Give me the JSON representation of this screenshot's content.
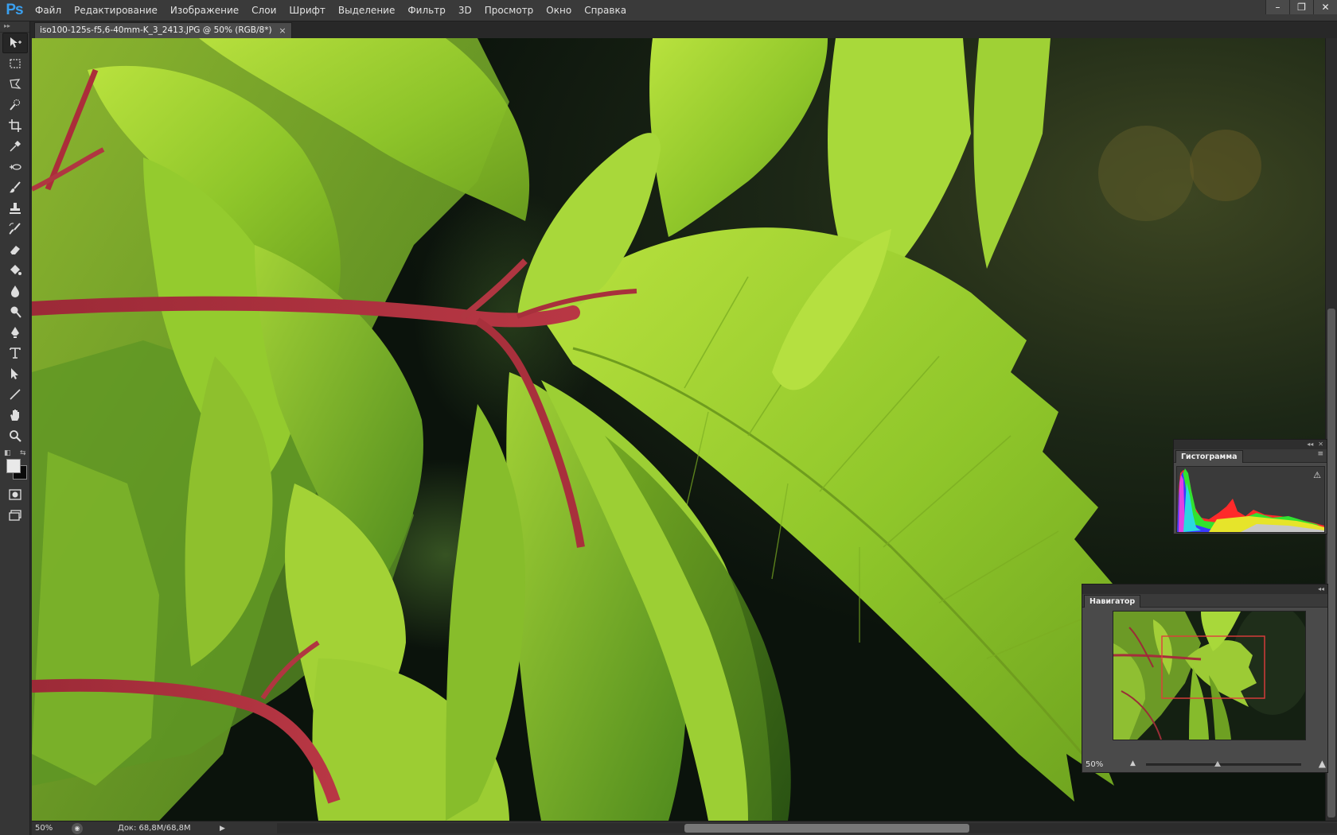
{
  "app": {
    "logo": "Ps"
  },
  "menu": [
    "Файл",
    "Редактирование",
    "Изображение",
    "Слои",
    "Шрифт",
    "Выделение",
    "Фильтр",
    "3D",
    "Просмотр",
    "Окно",
    "Справка"
  ],
  "window_controls": {
    "minimize": "–",
    "restore": "❐",
    "close": "✕"
  },
  "document_tab": {
    "title": "iso100-125s-f5,6-40mm-K_3_2413.JPG @ 50% (RGB/8*)",
    "close": "×"
  },
  "tools": [
    {
      "name": "move-tool",
      "icon": "move-icon"
    },
    {
      "name": "marquee-tool",
      "icon": "rect-marquee-icon"
    },
    {
      "name": "lasso-tool",
      "icon": "polygonal-lasso-icon"
    },
    {
      "name": "quick-selection-tool",
      "icon": "quick-selection-icon"
    },
    {
      "name": "crop-tool",
      "icon": "crop-icon"
    },
    {
      "name": "eyedropper-tool",
      "icon": "eyedropper-icon"
    },
    {
      "name": "spot-healing-tool",
      "icon": "healing-icon"
    },
    {
      "name": "brush-tool",
      "icon": "brush-icon"
    },
    {
      "name": "clone-stamp-tool",
      "icon": "stamp-icon"
    },
    {
      "name": "history-brush-tool",
      "icon": "history-brush-icon"
    },
    {
      "name": "eraser-tool",
      "icon": "eraser-icon"
    },
    {
      "name": "paint-bucket-tool",
      "icon": "bucket-icon"
    },
    {
      "name": "blur-tool",
      "icon": "drop-icon"
    },
    {
      "name": "dodge-tool",
      "icon": "dodge-icon"
    },
    {
      "name": "pen-tool",
      "icon": "pen-icon"
    },
    {
      "name": "type-tool",
      "icon": "type-icon"
    },
    {
      "name": "path-selection-tool",
      "icon": "path-select-icon"
    },
    {
      "name": "line-tool",
      "icon": "line-icon"
    },
    {
      "name": "hand-tool",
      "icon": "hand-icon"
    },
    {
      "name": "zoom-tool",
      "icon": "zoom-icon"
    }
  ],
  "colors": {
    "foreground": "#e9e9e9",
    "background": "#0a0a0a",
    "accent": "#3aa0ef"
  },
  "status": {
    "zoom": "50%",
    "doc_size": "Док: 68,8M/68,8M"
  },
  "histogram": {
    "tab": "Гистограмма",
    "warning_icon": "⚠",
    "menu_icon": "≡"
  },
  "navigator": {
    "tab": "Навигатор",
    "zoom": "50%",
    "viewport_color": "#e03c3c"
  }
}
